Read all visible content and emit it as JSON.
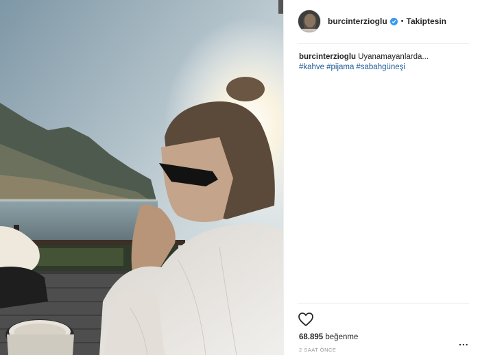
{
  "post": {
    "username": "burcinterzioglu",
    "follow_status": "Takiptesin",
    "caption_user": "burcinterzioglu",
    "caption_text": "Uyanamayanlarda...",
    "hashtags": [
      "#kahve",
      "#pijama",
      "#sabahgüneşi"
    ],
    "likes_count": "68.895",
    "likes_label": "beğenme",
    "timestamp": "2 SAAT ÖNCE",
    "more_options": "..."
  },
  "icons": {
    "verified": "verified-badge-icon",
    "like": "heart-icon",
    "more": "more-options-icon"
  },
  "colors": {
    "hashtag": "#1a5a96",
    "verified": "#3897f0",
    "text": "#262626",
    "muted": "#999999"
  }
}
